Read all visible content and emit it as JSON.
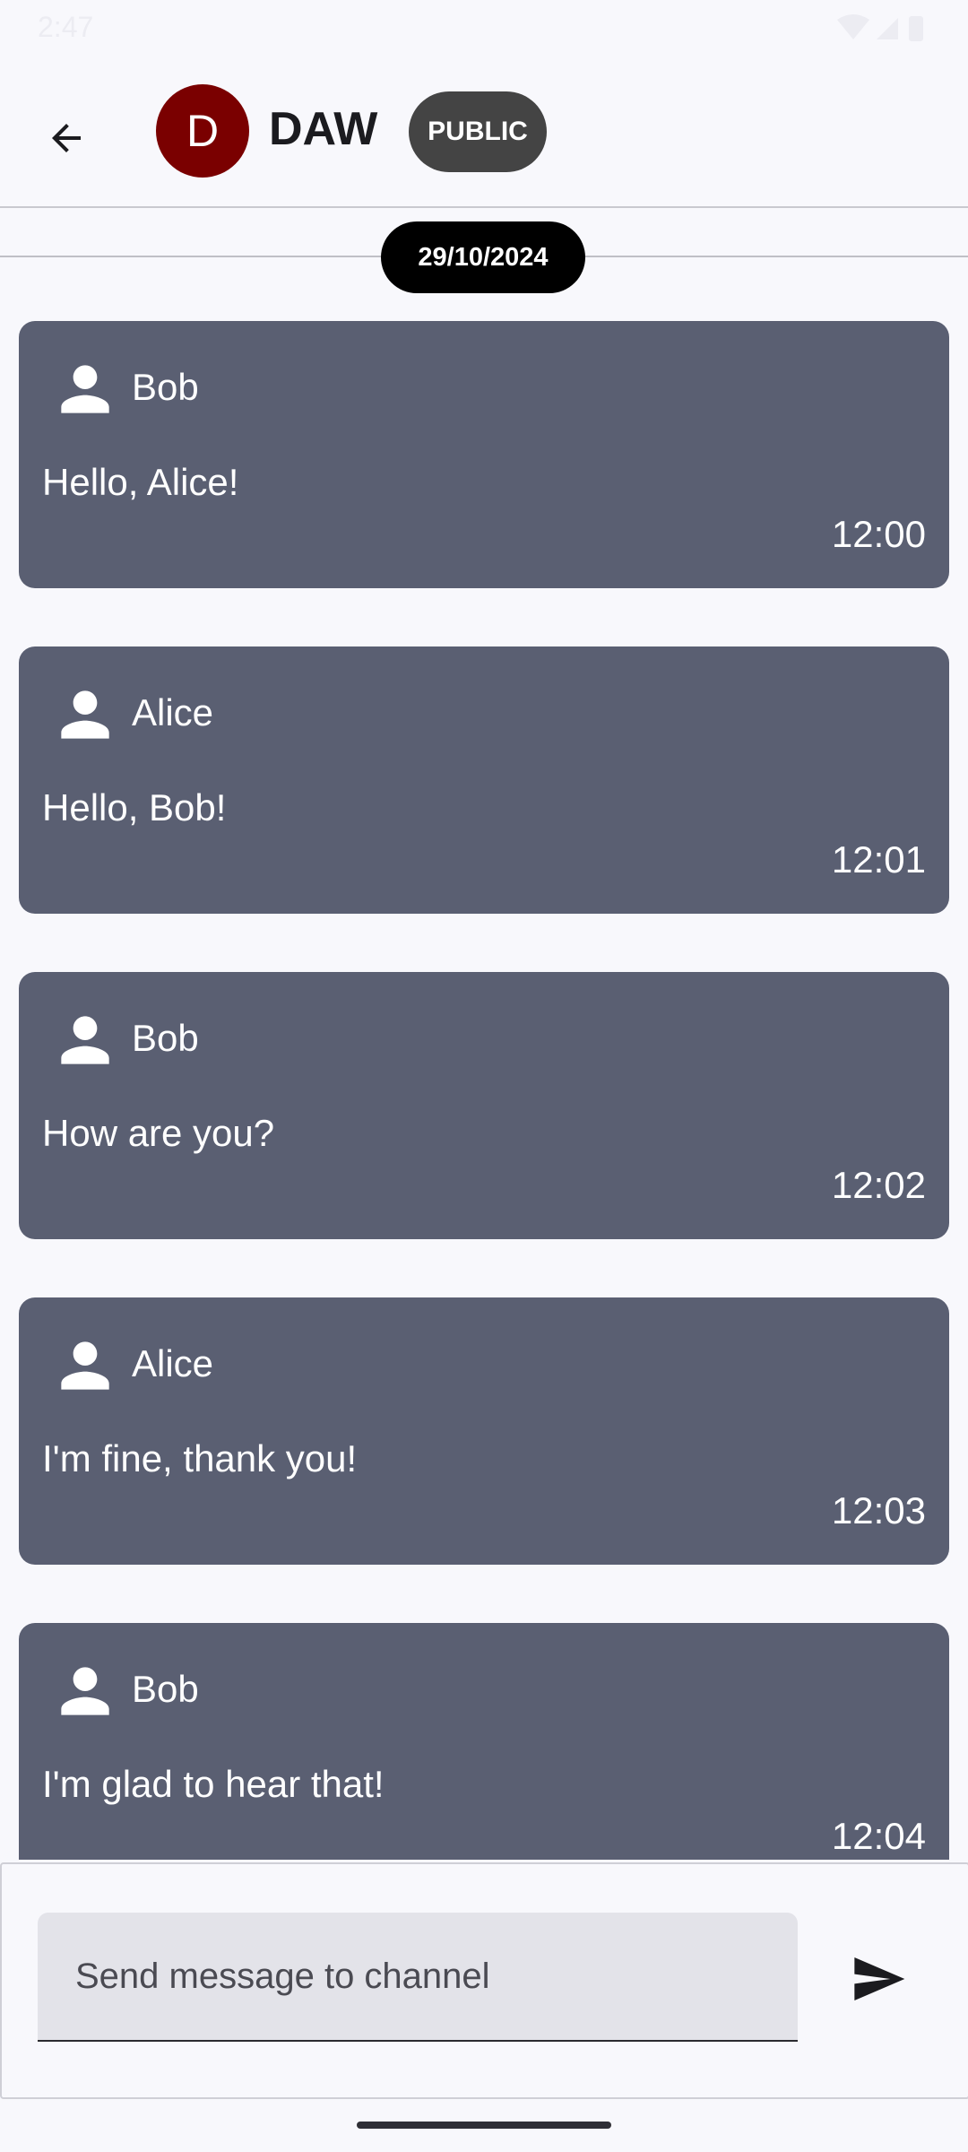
{
  "status_bar": {
    "time": "2:47"
  },
  "app_bar": {
    "avatar_letter": "D",
    "channel_name": "DAW",
    "visibility_chip": "PUBLIC"
  },
  "date_separator": "29/10/2024",
  "messages": [
    {
      "author": "Bob",
      "text": "Hello, Alice!",
      "time": "12:00"
    },
    {
      "author": "Alice",
      "text": "Hello, Bob!",
      "time": "12:01"
    },
    {
      "author": "Bob",
      "text": "How are you?",
      "time": "12:02"
    },
    {
      "author": "Alice",
      "text": "I'm fine, thank you!",
      "time": "12:03"
    },
    {
      "author": "Bob",
      "text": "I'm glad to hear that!",
      "time": "12:04"
    }
  ],
  "composer": {
    "placeholder": "Send message to channel",
    "value": ""
  },
  "colors": {
    "background": "#f8f8fc",
    "avatar": "#7a0000",
    "chip": "#444444",
    "message_card": "#5a5f72",
    "input_bg": "#e3e3e9"
  },
  "icons": {
    "back": "arrow-left-icon",
    "person": "person-icon",
    "send": "send-icon"
  }
}
